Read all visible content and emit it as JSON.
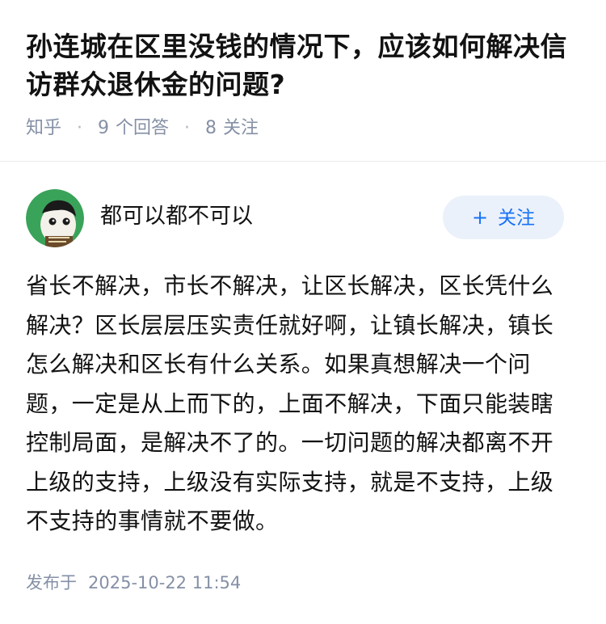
{
  "question": {
    "title": "孙连城在区里没钱的情况下，应该如何解决信访群众退休金的问题?",
    "source": "知乎",
    "answers_count": "9",
    "answers_label": "个回答",
    "followers_count": "8",
    "followers_label": "关注",
    "separator": "·"
  },
  "author": {
    "name": "都可以都不可以",
    "follow_label": "关注",
    "follow_plus": "+"
  },
  "answer": {
    "content": "省长不解决，市长不解决，让区长解决，区长凭什么解决？区长层层压实责任就好啊，让镇长解决，镇长怎么解决和区长有什么关系。如果真想解决一个问题，一定是从上而下的，上面不解决，下面只能装瞎控制局面，是解决不了的。一切问题的解决都离不开上级的支持，上级没有实际支持，就是不支持，上级不支持的事情就不要做。",
    "published_label": "发布于",
    "published_time": "2025-10-22 11:54"
  },
  "colors": {
    "accent": "#1772f6",
    "follow_bg": "#ebf1fa",
    "meta_text": "#8590a6",
    "avatar_bg": "#3aa35a"
  }
}
